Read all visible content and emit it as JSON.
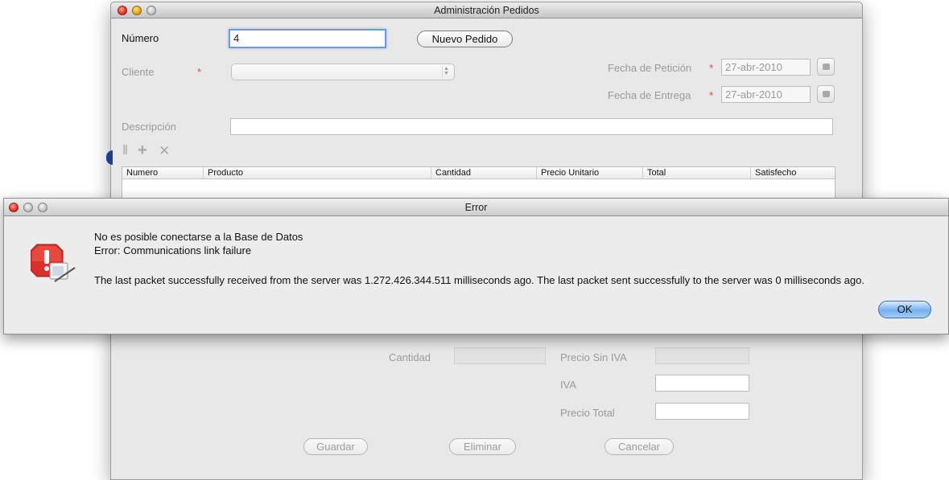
{
  "main_window": {
    "title": "Administración Pedidos",
    "numero_label": "Número",
    "numero_value": "4",
    "nuevo_pedido_button": "Nuevo Pedido",
    "cliente_label": "Cliente",
    "required_mark": "*",
    "cliente_value": "",
    "fecha_peticion_label": "Fecha de Petición",
    "fecha_peticion_value": "27-abr-2010",
    "fecha_entrega_label": "Fecha de Entrega",
    "fecha_entrega_value": "27-abr-2010",
    "descripcion_label": "Descripción",
    "descripcion_value": "",
    "toolbar": {
      "separator_glyph": "‖",
      "add_glyph": "+",
      "remove_glyph": "✕"
    },
    "table": {
      "columns": [
        "Numero",
        "Producto",
        "Cantidad",
        "Precio Unitario",
        "Total",
        "Satisfecho"
      ],
      "rows": []
    },
    "cantidad_label": "Cantidad",
    "cantidad_value": "",
    "precio_sin_iva_label": "Precio Sin IVA",
    "precio_sin_iva_value": "",
    "iva_label": "IVA",
    "iva_value": "",
    "precio_total_label": "Precio Total",
    "precio_total_value": "",
    "guardar_button": "Guardar",
    "eliminar_button": "Eliminar",
    "cancelar_button": "Cancelar"
  },
  "error_dialog": {
    "title": "Error",
    "icon": "stop-alert-icon",
    "line1": "No es posible conectarse a la Base de Datos",
    "line2": "Error: Communications link failure",
    "line3": "The last packet successfully received from the server was 1.272.426.344.511 milliseconds ago.  The last packet sent successfully to the server was 0 milliseconds ago.",
    "ok_button": "OK"
  },
  "colors": {
    "required": "#e0483b",
    "ok_button": "#77b0f1",
    "stop_icon": "#d9302c",
    "window_bg": "#e8e8e8"
  }
}
